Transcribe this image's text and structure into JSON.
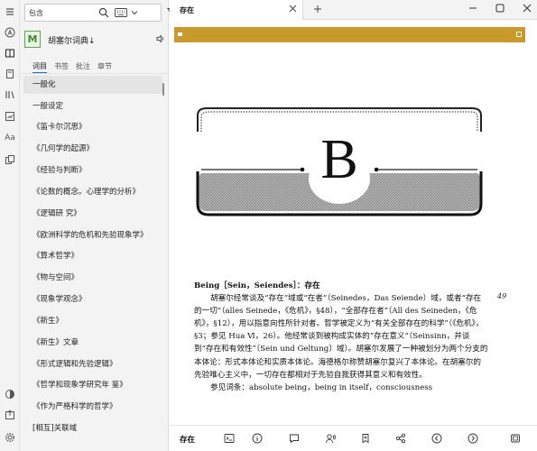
{
  "search": {
    "value": "包含"
  },
  "dictionary": {
    "name": "胡塞尔词典",
    "logo": "M"
  },
  "subtabs": [
    "词目",
    "书签",
    "批注",
    "章节"
  ],
  "list_items": [
    "一般化",
    "一般设定",
    "《笛卡尔沉思》",
    "《几何学的起源》",
    "《经验与判断》",
    "《论数的概念。心理学的分析》",
    "《逻辑研 究》",
    "《欧洲科学的危机和先验现象学》",
    "《算术哲学》",
    "《物与空间》",
    "《现象学观念》",
    "《新生》",
    "《新生》文章",
    "《形式逻辑和先验逻辑》",
    "《哲学和现象学研究年 鉴》",
    "《作为严格科学的哲学》",
    "[相互]关联域"
  ],
  "tab": {
    "label": "存在"
  },
  "page": {
    "letter": "B",
    "page_number": "49",
    "headword": "Being［Sein，Seiendes］：存在",
    "paragraph1": "胡塞尔经常谈及“存在”域或“在者”（Seinedes，Das Seiende）域，或者“存在的一切”（alles Seinede，《危机》，§48），“全部存在者”（All des Seineden，《危机》，§12），用以指意向性所针对者。哲学被定义为“有关全部存在的科学”（《危机》，§3；参见 Hua Ⅵ，26）。他经常谈到被构成实体的“存在意义”（Seinsinn，并谈到“存在和有效性”〔Sein und Geltung〕域）。胡塞尔发展了一种被划分为两个分支的本体论：形式本体论和实质本体论。海德格尔称赞胡塞尔复兴了本体论。在胡塞尔的先验唯心主义中，一切存在都相对于先验自我获得其意义和有效性。",
    "see_also": "参见词条：absolute being，being in itself，consciousness"
  },
  "footer": {
    "word": "存在"
  },
  "colors": {
    "accent": "#1a6fd6",
    "banner": "#c89a2b",
    "logo_green": "#5fa552"
  }
}
